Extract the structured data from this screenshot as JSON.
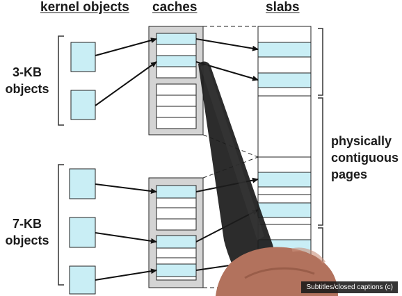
{
  "headers": {
    "kernel_objects": "kernel objects",
    "caches": "caches",
    "slabs": "slabs"
  },
  "groups": {
    "small": {
      "line1": "3-KB",
      "line2": "objects"
    },
    "large": {
      "line1": "7-KB",
      "line2": "objects"
    }
  },
  "side_label": {
    "line1": "physically",
    "line2": "contiguous",
    "line3": "pages"
  },
  "caption": "Subtitles/closed captions (c)",
  "colors": {
    "object_fill": "#c9eef5",
    "cache_fill": "#d4d4d4",
    "line": "#111111",
    "hand": "#1c1c1c"
  }
}
